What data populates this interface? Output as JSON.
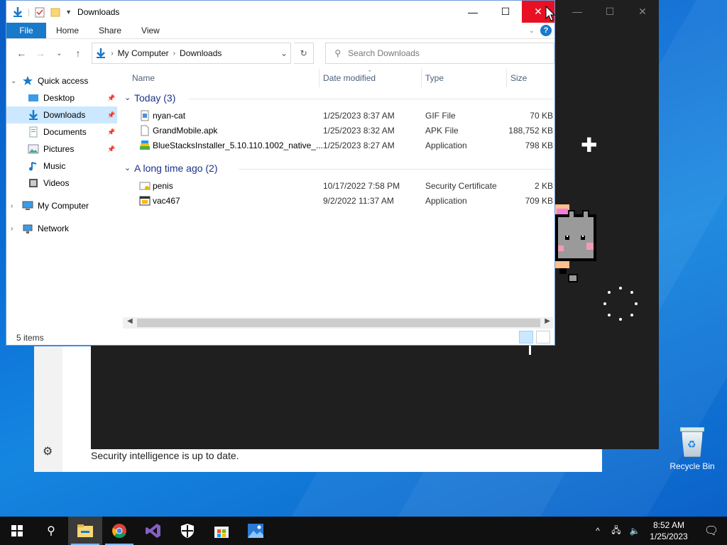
{
  "explorer": {
    "title": "Downloads",
    "ribbon_tabs": [
      "File",
      "Home",
      "Share",
      "View"
    ],
    "help": "?",
    "breadcrumb": [
      "My Computer",
      "Downloads"
    ],
    "search_placeholder": "Search Downloads",
    "nav": [
      {
        "label": "Quick access",
        "level": 0,
        "expanded": true,
        "icon": "star-icon"
      },
      {
        "label": "Desktop",
        "level": 1,
        "pinned": true,
        "icon": "desktop-folder-icon"
      },
      {
        "label": "Downloads",
        "level": 1,
        "pinned": true,
        "selected": true,
        "icon": "downloads-folder-icon"
      },
      {
        "label": "Documents",
        "level": 1,
        "pinned": true,
        "icon": "documents-folder-icon"
      },
      {
        "label": "Pictures",
        "level": 1,
        "pinned": true,
        "icon": "pictures-folder-icon"
      },
      {
        "label": "Music",
        "level": 1,
        "icon": "music-folder-icon"
      },
      {
        "label": "Videos",
        "level": 1,
        "icon": "videos-folder-icon"
      },
      {
        "label": "My Computer",
        "level": 0,
        "expanded": false,
        "icon": "computer-icon"
      },
      {
        "label": "Network",
        "level": 0,
        "expanded": false,
        "icon": "network-icon"
      }
    ],
    "columns": [
      "Name",
      "Date modified",
      "Type",
      "Size"
    ],
    "groups": [
      {
        "label": "Today (3)",
        "files": [
          {
            "name": "nyan-cat",
            "date": "1/25/2023 8:37 AM",
            "type": "GIF File",
            "size": "70 KB",
            "icon": "gif-file-icon"
          },
          {
            "name": "GrandMobile.apk",
            "date": "1/25/2023 8:32 AM",
            "type": "APK File",
            "size": "188,752 KB",
            "icon": "blank-file-icon"
          },
          {
            "name": "BlueStacksInstaller_5.10.110.1002_native_...",
            "date": "1/25/2023 8:27 AM",
            "type": "Application",
            "size": "798 KB",
            "icon": "bluestacks-icon"
          }
        ]
      },
      {
        "label": "A long time ago (2)",
        "files": [
          {
            "name": "penis",
            "date": "10/17/2022 7:58 PM",
            "type": "Security Certificate",
            "size": "2 KB",
            "icon": "certificate-icon"
          },
          {
            "name": "vac467",
            "date": "9/2/2022 11:37 AM",
            "type": "Application",
            "size": "709 KB",
            "icon": "application-icon"
          }
        ]
      }
    ],
    "status": "5 items"
  },
  "defender": {
    "message": "Security intelligence is up to date."
  },
  "desktop": {
    "recycle_bin": "Recycle Bin"
  },
  "taskbar": {
    "time": "8:52 AM",
    "date": "1/25/2023",
    "apps": [
      "start-icon",
      "search-icon",
      "file-explorer-icon",
      "chrome-icon",
      "visual-studio-icon",
      "windows-security-icon",
      "store-icon",
      "photos-icon"
    ]
  }
}
